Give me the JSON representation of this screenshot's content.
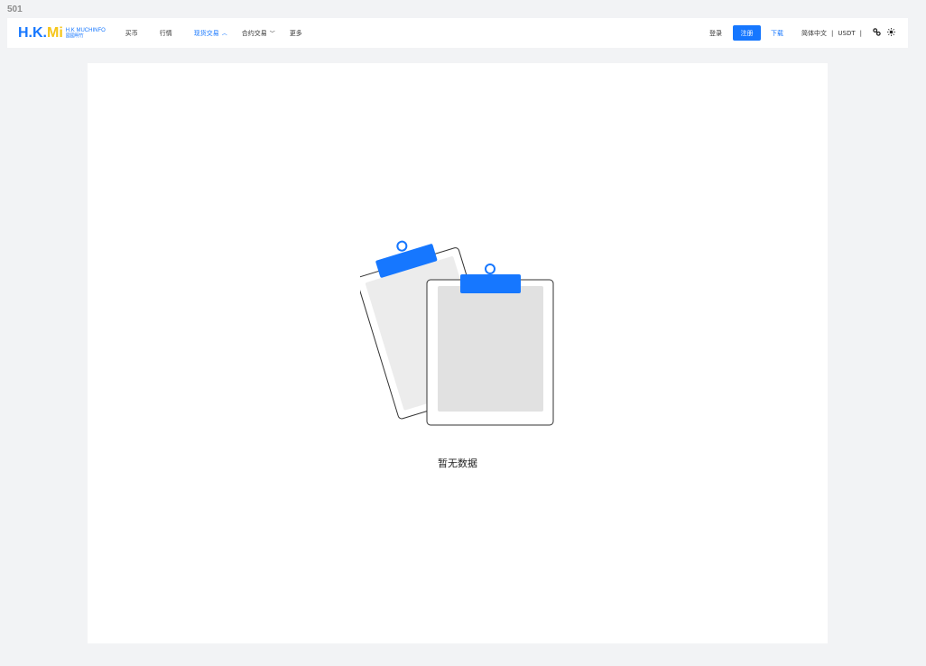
{
  "frame_label": "501",
  "logo": {
    "mark_part1": "H.K.",
    "mark_part2": "Mi",
    "text_en": "H.K MUCHINFO",
    "text_cn": "國國明竹"
  },
  "nav": {
    "items": [
      {
        "label": "买币"
      },
      {
        "label": "行情"
      },
      {
        "label": "现货交易",
        "chevron": "^"
      },
      {
        "label": "合约交易",
        "chevron": "v"
      },
      {
        "label": "更多"
      }
    ]
  },
  "header_right": {
    "login": "登录",
    "register": "注册",
    "download": "下载",
    "language": "简体中文",
    "separator": "|",
    "currency": "USDT",
    "icons": {
      "settings": "link-icon",
      "theme": "sun-icon"
    }
  },
  "colors": {
    "accent": "#1677ff",
    "logo_yellow": "#f5c518",
    "page_bg": "#f2f3f5",
    "card_bg": "#ffffff"
  },
  "empty_state": {
    "text": "暂无数据",
    "icon": "empty-clipboard-icon"
  }
}
